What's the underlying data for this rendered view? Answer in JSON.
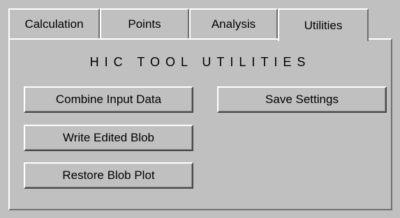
{
  "tabs": [
    {
      "label": "Calculation"
    },
    {
      "label": "Points"
    },
    {
      "label": "Analysis"
    },
    {
      "label": "Utilities"
    }
  ],
  "active_tab": "Utilities",
  "panel": {
    "title": "HIC TOOL UTILITIES"
  },
  "buttons": {
    "combine_input_data": "Combine Input Data",
    "save_settings": "Save Settings",
    "write_edited_blob": "Write Edited Blob",
    "restore_blob_plot": "Restore Blob Plot"
  },
  "colors": {
    "background": "#c0c0c0",
    "highlight": "#ffffff",
    "shadow": "#4a4a4a"
  }
}
